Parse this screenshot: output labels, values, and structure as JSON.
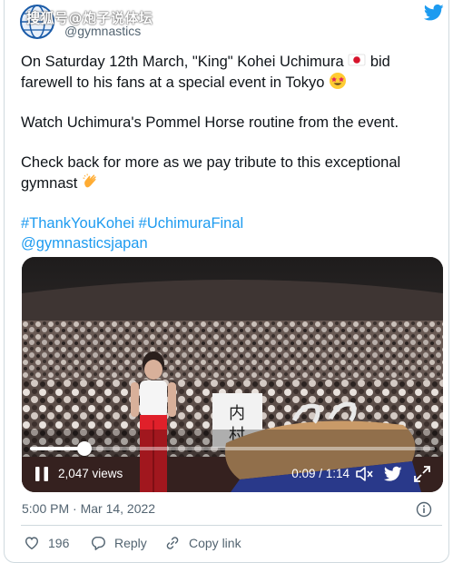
{
  "header": {
    "watermark": "搜狐号@炮子说体坛",
    "handle": "@gymnastics"
  },
  "tweet": {
    "paragraphs": [
      {
        "line1_before": "On Saturday 12th March, \"King\" Kohei Uchimura ",
        "line1_after": " bid farewell to his fans at a special event in Tokyo "
      },
      {
        "text": "Watch Uchimura's Pommel Horse routine from the event."
      },
      {
        "before": "Check back for more as we pay tribute to this exceptional gymnast "
      }
    ],
    "hashtags": "#ThankYouKohei #UchimuraFinal",
    "mention": "@gymnasticsjapan"
  },
  "video": {
    "views": "2,047 views",
    "time": "0:09 / 1:14",
    "progress": 0.135
  },
  "meta": {
    "timestamp": "5:00 PM · Mar 14, 2022"
  },
  "actions": {
    "likes": "196",
    "reply": "Reply",
    "copy_link": "Copy link"
  },
  "colors": {
    "accent": "#1d9bf0",
    "text": "#0f1419",
    "muted": "#536471"
  }
}
